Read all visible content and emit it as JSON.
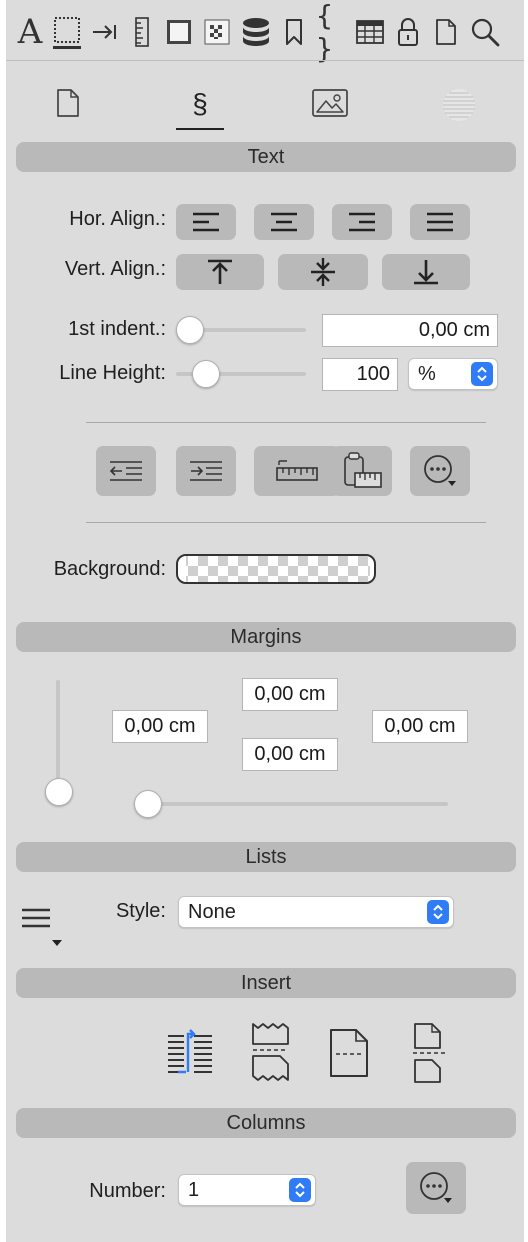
{
  "toolbar": {
    "items": [
      "text-style-icon",
      "frame-icon",
      "tab-icon",
      "ruler-icon",
      "box-icon",
      "checker-icon",
      "database-icon",
      "bookmark-icon",
      "braces-icon",
      "table-icon",
      "lock-icon",
      "document-icon",
      "search-icon"
    ],
    "font_glyph": "A",
    "braces_glyph": "{ }"
  },
  "tabs": {
    "items": [
      "document-tab",
      "paragraph-tab",
      "image-tab",
      "pattern-tab"
    ],
    "paragraph_glyph": "§",
    "active": "paragraph-tab"
  },
  "sections": {
    "text": "Text",
    "margins": "Margins",
    "lists": "Lists",
    "insert": "Insert",
    "columns": "Columns"
  },
  "text": {
    "hor_align_label": "Hor. Align.:",
    "vert_align_label": "Vert. Align.:",
    "first_indent_label": "1st indent.:",
    "first_indent_value": "0,00 cm",
    "first_indent_slider": 0,
    "line_height_label": "Line Height:",
    "line_height_value": "100",
    "line_height_unit": "%",
    "background_label": "Background:"
  },
  "margins": {
    "left": "0,00 cm",
    "top": "0,00 cm",
    "bottom": "0,00 cm",
    "right": "0,00 cm",
    "vertical_slider": 0,
    "horizontal_slider": 0
  },
  "lists": {
    "style_label": "Style:",
    "style_value": "None"
  },
  "columns": {
    "number_label": "Number:",
    "number_value": "1"
  },
  "colors": {
    "panel": "#dcdcdc",
    "section_bar": "#b9b9b9",
    "accent": "#2f7cf6"
  }
}
